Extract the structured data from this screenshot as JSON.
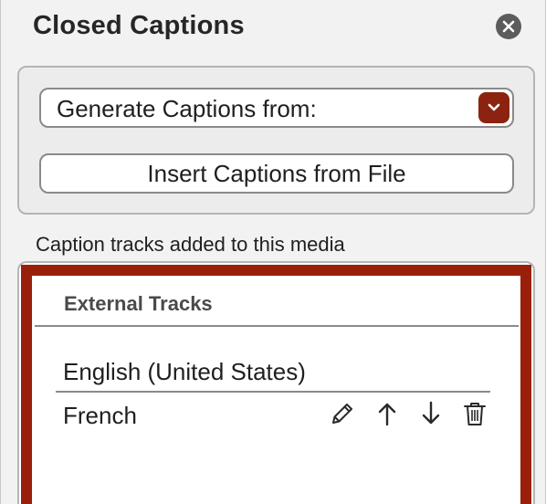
{
  "panel": {
    "title": "Closed Captions",
    "close_icon": "close-circle-icon"
  },
  "caption_source": {
    "dropdown_label": "Generate Captions from:",
    "dropdown_icon": "chevron-down-icon",
    "accent_color": "#8b2310",
    "insert_button_label": "Insert Captions from File"
  },
  "tracks": {
    "label": "Caption tracks added to this media",
    "focus_color": "#9a1f0a",
    "section_header": "External Tracks",
    "items": [
      {
        "name": "English (United States)"
      },
      {
        "name": "French",
        "actions": [
          "pencil-icon",
          "arrow-up-icon",
          "arrow-down-icon",
          "trash-icon"
        ]
      }
    ]
  }
}
